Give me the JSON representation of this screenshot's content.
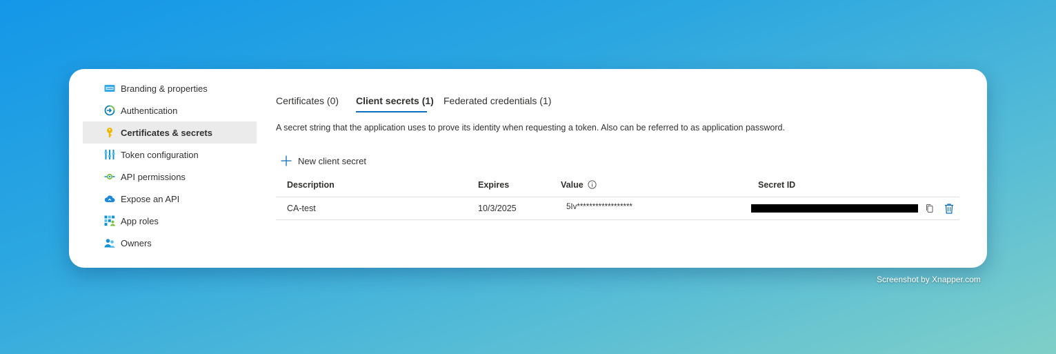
{
  "sidebar": {
    "items": [
      {
        "label": "Branding & properties",
        "icon": "branding-icon"
      },
      {
        "label": "Authentication",
        "icon": "authentication-icon"
      },
      {
        "label": "Certificates & secrets",
        "icon": "key-icon",
        "active": true
      },
      {
        "label": "Token configuration",
        "icon": "token-config-icon"
      },
      {
        "label": "API permissions",
        "icon": "api-permissions-icon"
      },
      {
        "label": "Expose an API",
        "icon": "cloud-icon"
      },
      {
        "label": "App roles",
        "icon": "app-roles-icon"
      },
      {
        "label": "Owners",
        "icon": "owners-icon"
      }
    ]
  },
  "tabs": [
    {
      "label": "Certificates (0)"
    },
    {
      "label": "Client secrets (1)",
      "active": true
    },
    {
      "label": "Federated credentials (1)"
    }
  ],
  "description": "A secret string that the application uses to prove its identity when requesting a token. Also can be referred to as application password.",
  "new_secret_label": "New client secret",
  "table": {
    "headers": {
      "description": "Description",
      "expires": "Expires",
      "value": "Value",
      "secret_id": "Secret ID"
    },
    "rows": [
      {
        "description": "CA-test",
        "expires": "10/3/2025",
        "value": "5Iv******************"
      }
    ]
  },
  "watermark": "Screenshot by Xnapper.com",
  "colors": {
    "accent": "#0f6cbd",
    "active_bg": "#ebebeb",
    "key_yellow": "#f2b800"
  }
}
